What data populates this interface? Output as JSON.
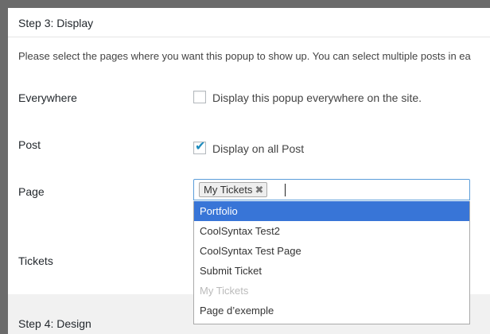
{
  "step3": {
    "title": "Step 3: Display",
    "description": "Please select the pages where you want this popup to show up. You can select multiple posts in ea"
  },
  "everywhere": {
    "label": "Everywhere",
    "checkbox_label": "Display this popup everywhere on the site.",
    "checked": false
  },
  "post": {
    "label": "Post",
    "checkbox_label": "Display on all Post",
    "checked": true
  },
  "page": {
    "label": "Page",
    "selected": [
      "My Tickets"
    ],
    "options": [
      {
        "label": "Portfolio",
        "state": "highlighted"
      },
      {
        "label": "CoolSyntax Test2",
        "state": "normal"
      },
      {
        "label": "CoolSyntax Test Page",
        "state": "normal"
      },
      {
        "label": "Submit Ticket",
        "state": "normal"
      },
      {
        "label": "My Tickets",
        "state": "disabled"
      },
      {
        "label": "Page d’exemple",
        "state": "normal"
      }
    ]
  },
  "tickets": {
    "label": "Tickets"
  },
  "step4": {
    "title": "Step 4: Design"
  },
  "colors": {
    "accent": "#3875d7",
    "checkmark": "#1e8cbe"
  }
}
